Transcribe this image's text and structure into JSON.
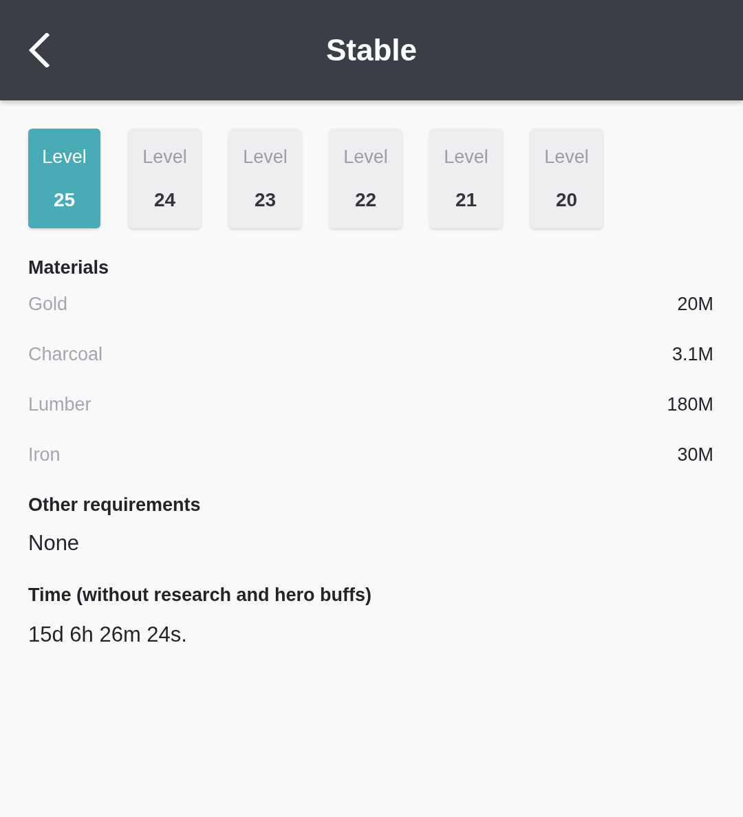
{
  "header": {
    "title": "Stable"
  },
  "levels": [
    {
      "label": "Level",
      "number": "25",
      "selected": true
    },
    {
      "label": "Level",
      "number": "24",
      "selected": false
    },
    {
      "label": "Level",
      "number": "23",
      "selected": false
    },
    {
      "label": "Level",
      "number": "22",
      "selected": false
    },
    {
      "label": "Level",
      "number": "21",
      "selected": false
    },
    {
      "label": "Level",
      "number": "20",
      "selected": false
    }
  ],
  "materials": {
    "heading": "Materials",
    "rows": [
      {
        "name": "Gold",
        "value": "20M"
      },
      {
        "name": "Charcoal",
        "value": "3.1M"
      },
      {
        "name": "Lumber",
        "value": "180M"
      },
      {
        "name": "Iron",
        "value": "30M"
      }
    ]
  },
  "other_requirements": {
    "heading": "Other requirements",
    "value": "None"
  },
  "time": {
    "heading": "Time (without research and hero buffs)",
    "value": "15d 6h 26m 24s."
  }
}
